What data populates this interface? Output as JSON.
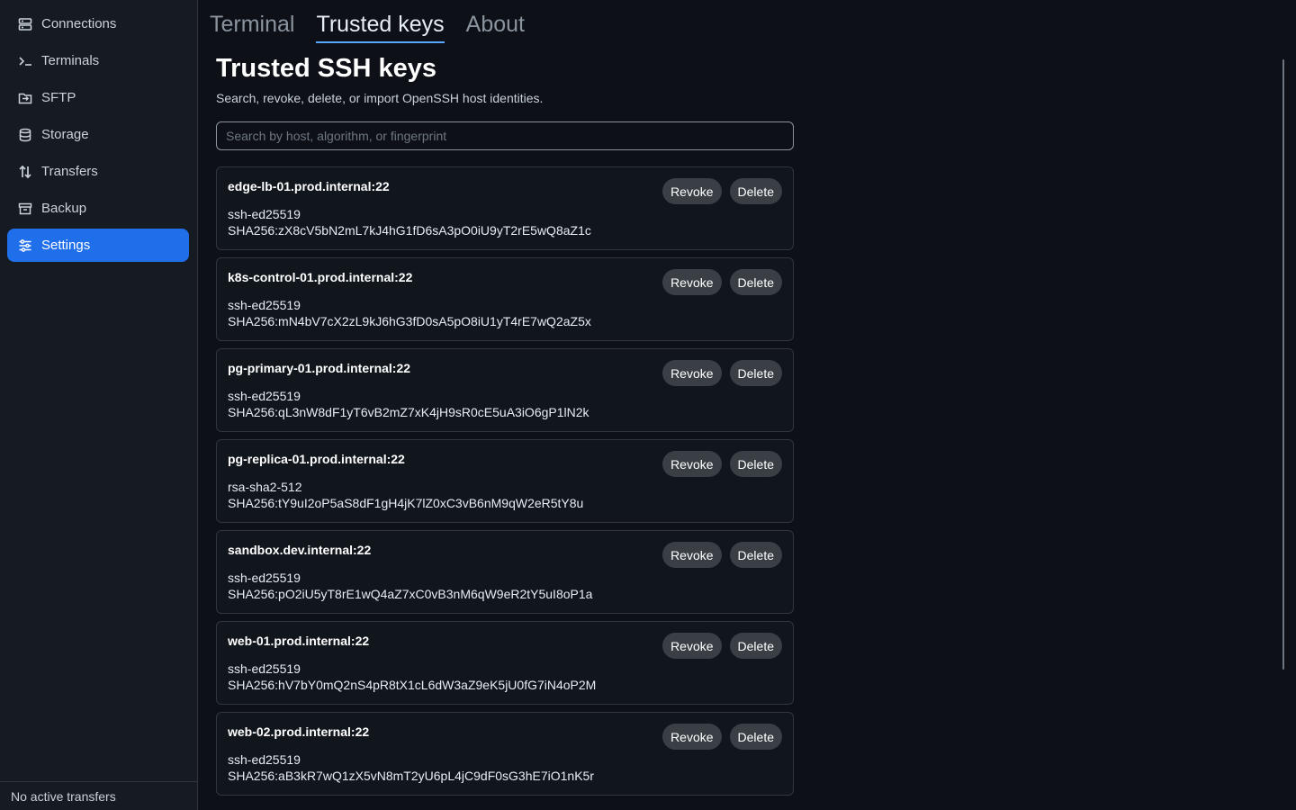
{
  "sidebar": {
    "items": [
      {
        "label": "Connections",
        "icon": "server-icon",
        "active": false
      },
      {
        "label": "Terminals",
        "icon": "terminal-icon",
        "active": false
      },
      {
        "label": "SFTP",
        "icon": "folder-transfer-icon",
        "active": false
      },
      {
        "label": "Storage",
        "icon": "database-icon",
        "active": false
      },
      {
        "label": "Transfers",
        "icon": "transfer-arrows-icon",
        "active": false
      },
      {
        "label": "Backup",
        "icon": "archive-icon",
        "active": false
      },
      {
        "label": "Settings",
        "icon": "sliders-icon",
        "active": true
      }
    ],
    "footer_status": "No active transfers"
  },
  "tabs": [
    {
      "label": "Terminal",
      "active": false
    },
    {
      "label": "Trusted keys",
      "active": true
    },
    {
      "label": "About",
      "active": false
    }
  ],
  "page": {
    "title": "Trusted SSH keys",
    "subtitle": "Search, revoke, delete, or import OpenSSH host identities.",
    "search_placeholder": "Search by host, algorithm, or fingerprint"
  },
  "actions": {
    "revoke_label": "Revoke",
    "delete_label": "Delete"
  },
  "keys": [
    {
      "host": "edge-lb-01.prod.internal:22",
      "algorithm": "ssh-ed25519",
      "fingerprint": "SHA256:zX8cV5bN2mL7kJ4hG1fD6sA3pO0iU9yT2rE5wQ8aZ1c"
    },
    {
      "host": "k8s-control-01.prod.internal:22",
      "algorithm": "ssh-ed25519",
      "fingerprint": "SHA256:mN4bV7cX2zL9kJ6hG3fD0sA5pO8iU1yT4rE7wQ2aZ5x"
    },
    {
      "host": "pg-primary-01.prod.internal:22",
      "algorithm": "ssh-ed25519",
      "fingerprint": "SHA256:qL3nW8dF1yT6vB2mZ7xK4jH9sR0cE5uA3iO6gP1lN2k"
    },
    {
      "host": "pg-replica-01.prod.internal:22",
      "algorithm": "rsa-sha2-512",
      "fingerprint": "SHA256:tY9uI2oP5aS8dF1gH4jK7lZ0xC3vB6nM9qW2eR5tY8u"
    },
    {
      "host": "sandbox.dev.internal:22",
      "algorithm": "ssh-ed25519",
      "fingerprint": "SHA256:pO2iU5yT8rE1wQ4aZ7xC0vB3nM6qW9eR2tY5uI8oP1a"
    },
    {
      "host": "web-01.prod.internal:22",
      "algorithm": "ssh-ed25519",
      "fingerprint": "SHA256:hV7bY0mQ2nS4pR8tX1cL6dW3aZ9eK5jU0fG7iN4oP2M"
    },
    {
      "host": "web-02.prod.internal:22",
      "algorithm": "ssh-ed25519",
      "fingerprint": "SHA256:aB3kR7wQ1zX5vN8mT2yU6pL4jC9dF0sG3hE7iO1nK5r"
    }
  ],
  "colors": {
    "accent": "#1f6feb",
    "tab_underline": "#58a6ff",
    "background": "#0d1117",
    "sidebar": "#161b22"
  }
}
